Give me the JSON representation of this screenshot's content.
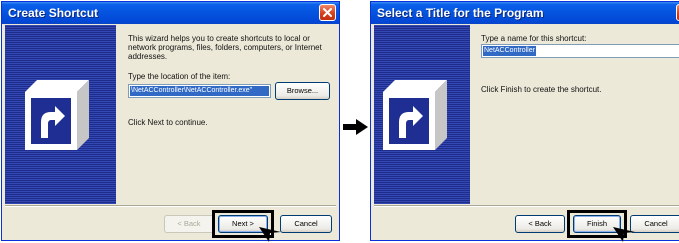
{
  "wizard1": {
    "title": "Create Shortcut",
    "description": "This wizard helps you to create shortcuts to local or network programs, files, folders, computers, or Internet addresses.",
    "location_label": "Type the location of the item:",
    "location_value": "\\NetACController\\NetACController.exe\"",
    "browse_label": "Browse...",
    "instruction": "Click Next to continue.",
    "back_label": "< Back",
    "next_label": "Next >",
    "cancel_label": "Cancel"
  },
  "wizard2": {
    "title": "Select a Title for the Program",
    "name_label": "Type a name for this shortcut:",
    "name_value": "NetACController",
    "instruction": "Click Finish to create the shortcut.",
    "back_label": "< Back",
    "finish_label": "Finish",
    "cancel_label": "Cancel"
  },
  "icons": {
    "flow": "right-arrow-icon",
    "shortcut": "shortcut-arrow-icon",
    "close": "close-icon"
  },
  "colors": {
    "titlebar": "#0553e0",
    "dialog_bg": "#ece9d8",
    "sidebar": "#2f3fa8",
    "selection": "#316ac5",
    "highlight_box": "#000000"
  }
}
